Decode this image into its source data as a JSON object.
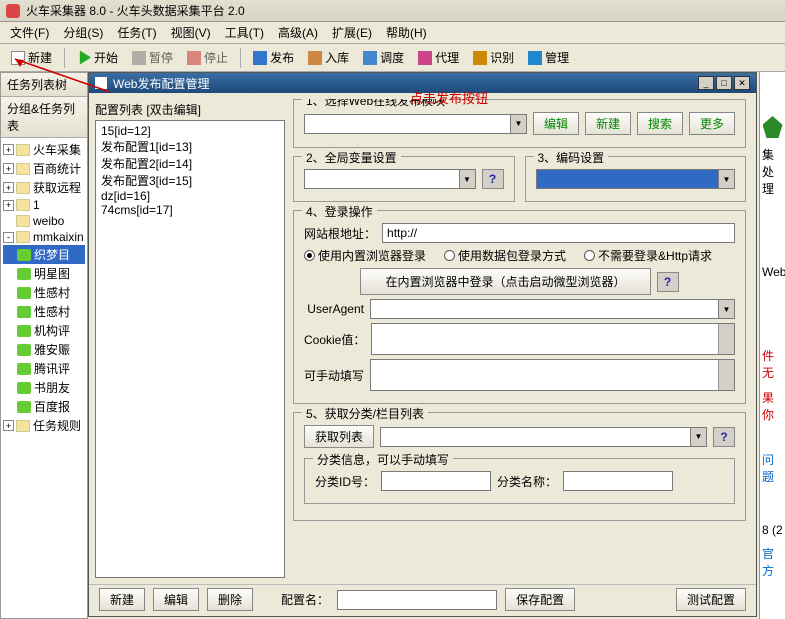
{
  "title": "火车采集器 8.0 - 火车头数据采集平台 2.0",
  "menu": {
    "file": "文件(F)",
    "group": "分组(S)",
    "task": "任务(T)",
    "view": "视图(V)",
    "tool": "工具(T)",
    "adv": "高级(A)",
    "ext": "扩展(E)",
    "help": "帮助(H)"
  },
  "toolbar": {
    "new": "新建",
    "start": "开始",
    "pause": "暂停",
    "stop": "停止",
    "publish": "发布",
    "import": "入库",
    "schedule": "调度",
    "proxy": "代理",
    "ocr": "识别",
    "manage": "管理"
  },
  "annotation": "点击发布按钮",
  "left": {
    "hd1": "任务列表树",
    "hd2": "分组&任务列表",
    "tree": [
      {
        "t": "火车采集",
        "exp": "+",
        "k": "fold"
      },
      {
        "t": "百商统计",
        "exp": "+",
        "k": "fold"
      },
      {
        "t": "获取远程",
        "exp": "+",
        "k": "fold"
      },
      {
        "t": "1",
        "exp": "+",
        "k": "fold"
      },
      {
        "t": "weibo",
        "exp": "",
        "k": "fold"
      },
      {
        "t": "mmkaixin",
        "exp": "-",
        "k": "fold"
      },
      {
        "t": "织梦目",
        "k": "leaf",
        "sel": true,
        "ind": 1
      },
      {
        "t": "明星图",
        "k": "leaf",
        "ind": 1
      },
      {
        "t": "性感村",
        "k": "leaf",
        "ind": 1
      },
      {
        "t": "性感村",
        "k": "leaf",
        "ind": 1
      },
      {
        "t": "机构评",
        "k": "leaf",
        "ind": 1
      },
      {
        "t": "雅安赈",
        "k": "leaf",
        "ind": 1
      },
      {
        "t": "腾讯评",
        "k": "leaf",
        "ind": 1
      },
      {
        "t": "书朋友",
        "k": "leaf",
        "ind": 1
      },
      {
        "t": "百度报",
        "k": "leaf",
        "ind": 1
      },
      {
        "t": "任务规则",
        "exp": "+",
        "k": "fold"
      }
    ]
  },
  "dialog": {
    "title": "Web发布配置管理",
    "listhd": "配置列表  [双击编辑]",
    "list": [
      "15[id=12]",
      "发布配置1[id=13]",
      "发布配置2[id=14]",
      "发布配置3[id=15]",
      "dz[id=16]",
      "74cms[id=17]"
    ],
    "s1": "1、选择Web在线发布模块",
    "s2": "2、全局变量设置",
    "s3": "3、编码设置",
    "s4": "4、登录操作",
    "s5": "5、获取分类/栏目列表",
    "btn_edit": "编辑",
    "btn_new": "新建",
    "btn_search": "搜索",
    "btn_more": "更多",
    "lbl_root": "网站根地址：",
    "val_root": "http://",
    "rad1": "使用内置浏览器登录",
    "rad2": "使用数据包登录方式",
    "rad3": "不需要登录&Http请求",
    "btn_browser": "在内置浏览器中登录（点击启动微型浏览器）",
    "lbl_ua": "UserAgent",
    "lbl_cookie": "Cookie值：",
    "lbl_manual": "可手动填写",
    "btn_getlist": "获取列表",
    "cat_info": "分类信息，可以手动填写",
    "lbl_catid": "分类ID号：",
    "lbl_catname": "分类名称：",
    "btn_new2": "新建",
    "btn_edit2": "编辑",
    "btn_del": "删除",
    "lbl_cfgname": "配置名：",
    "btn_save": "保存配置",
    "btn_test": "测试配置"
  },
  "farright": {
    "proc": "集处理",
    "web": "Web",
    "err1": "件无",
    "err2": "果你",
    "q": "问题",
    "v": "8 (2",
    "off": "官方"
  }
}
